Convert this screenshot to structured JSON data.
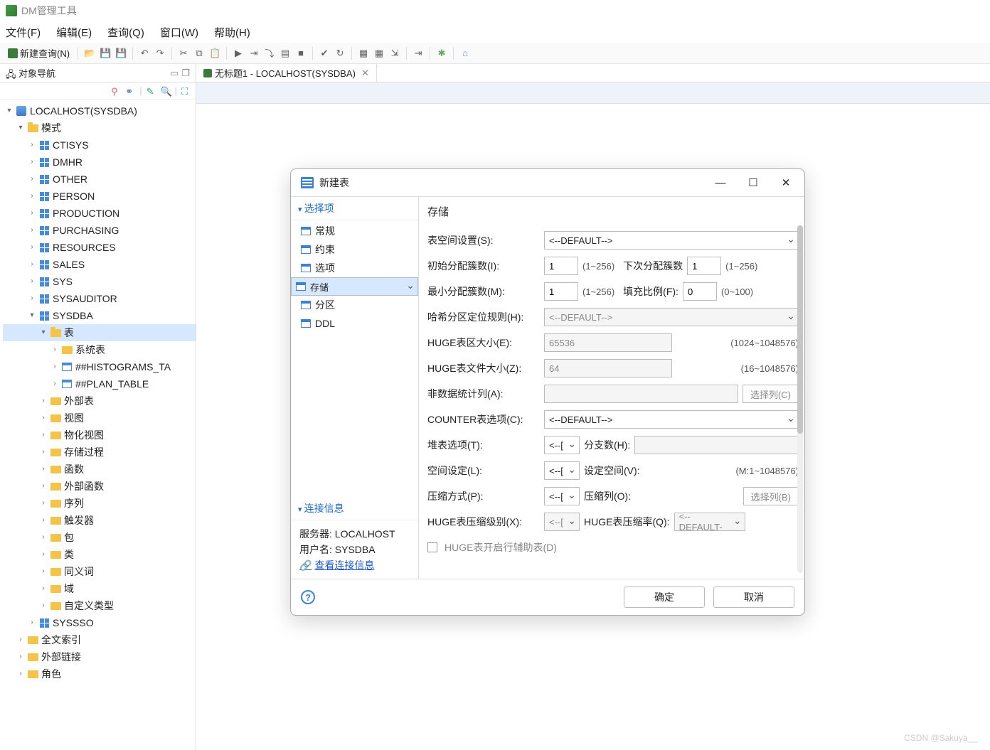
{
  "app": {
    "title": "DM管理工具"
  },
  "menu": {
    "file": "文件(F)",
    "edit": "编辑(E)",
    "query": "查询(Q)",
    "window": "窗口(W)",
    "help": "帮助(H)"
  },
  "toolbar": {
    "new_query": "新建查询(N)"
  },
  "nav": {
    "title": "对象导航",
    "root": "LOCALHOST(SYSDBA)",
    "schema": "模式",
    "schemas": [
      "CTISYS",
      "DMHR",
      "OTHER",
      "PERSON",
      "PRODUCTION",
      "PURCHASING",
      "RESOURCES",
      "SALES",
      "SYS",
      "SYSAUDITOR",
      "SYSDBA"
    ],
    "sysdba_table": "表",
    "sys_tables": "系统表",
    "tbl1": "##HISTOGRAMS_TA",
    "tbl2": "##PLAN_TABLE",
    "folders": [
      "外部表",
      "视图",
      "物化视图",
      "存储过程",
      "函数",
      "外部函数",
      "序列",
      "触发器",
      "包",
      "类",
      "同义词",
      "域",
      "自定义类型"
    ],
    "syssso": "SYSSSO",
    "fulltext": "全文索引",
    "extlink": "外部链接",
    "role": "角色"
  },
  "editor": {
    "tab": "无标题1 - LOCALHOST(SYSDBA)"
  },
  "dialog": {
    "title": "新建表",
    "section_select": "选择项",
    "side_items": [
      "常规",
      "约束",
      "选项",
      "存储",
      "分区",
      "DDL"
    ],
    "section_conn": "连接信息",
    "conn_server_lbl": "服务器:",
    "conn_server": "LOCALHOST",
    "conn_user_lbl": "用户名:",
    "conn_user": "SYSDBA",
    "conn_view": "查看连接信息",
    "heading": "存储",
    "rows": {
      "tablespace_lbl": "表空间设置(S):",
      "tablespace_val": "<--DEFAULT-->",
      "init_lbl": "初始分配簇数(I):",
      "init_val": "1",
      "init_rng": "(1~256)",
      "next_lbl": "下次分配簇数",
      "next_val": "1",
      "next_rng": "(1~256)",
      "min_lbl": "最小分配簇数(M):",
      "min_val": "1",
      "min_rng": "(1~256)",
      "fill_lbl": "填充比例(F):",
      "fill_val": "0",
      "fill_rng": "(0~100)",
      "hash_lbl": "哈希分区定位规则(H):",
      "hash_val": "<--DEFAULT-->",
      "huge_ext_lbl": "HUGE表区大小(E):",
      "huge_ext_val": "65536",
      "huge_ext_rng": "(1024~1048576)",
      "huge_file_lbl": "HUGE表文件大小(Z):",
      "huge_file_val": "64",
      "huge_file_rng": "(16~1048576)",
      "nonstat_lbl": "非数据统计列(A):",
      "nonstat_btn": "选择列(C)",
      "counter_lbl": "COUNTER表选项(C):",
      "counter_val": "<--DEFAULT-->",
      "heap_lbl": "堆表选项(T):",
      "heap_val": "<--[",
      "branch_lbl": "分支数(H):",
      "space_lbl": "空间设定(L):",
      "space_val": "<--[",
      "spacev_lbl": "设定空间(V):",
      "spacev_rng": "(M:1~1048576)",
      "comp_lbl": "压缩方式(P):",
      "comp_val": "<--[",
      "compcol_lbl": "压缩列(O):",
      "compcol_btn": "选择列(B)",
      "hugecomp_lbl": "HUGE表压缩级别(X):",
      "hugecomp_val": "<--[",
      "hugerate_lbl": "HUGE表压缩率(Q):",
      "hugerate_val": "<--DEFAULT-",
      "aux_lbl": "HUGE表开启行辅助表(D)"
    },
    "ok": "确定",
    "cancel": "取消"
  },
  "watermark": "CSDN @Sakuya__"
}
